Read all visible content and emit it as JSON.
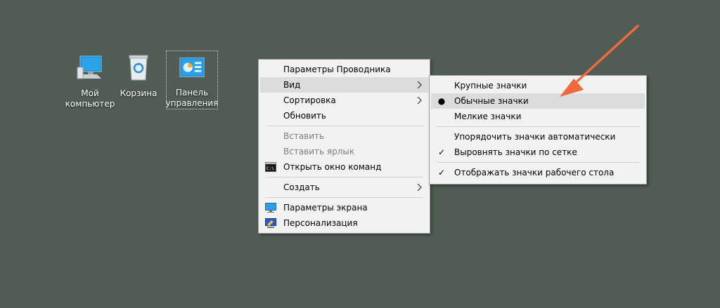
{
  "desktop": {
    "icons": [
      {
        "label": "Мой\nкомпьютер",
        "icon": "computer-icon"
      },
      {
        "label": "Корзина",
        "icon": "recycle-bin-icon"
      },
      {
        "label": "Панель\nуправления",
        "icon": "control-panel-icon"
      }
    ]
  },
  "context_menu": {
    "items": [
      {
        "label": "Параметры Проводника"
      },
      {
        "label": "Вид",
        "submenu": true
      },
      {
        "label": "Сортировка",
        "submenu": true
      },
      {
        "label": "Обновить"
      },
      {
        "label": "Вставить",
        "disabled": true
      },
      {
        "label": "Вставить ярлык",
        "disabled": true
      },
      {
        "label": "Открыть окно команд",
        "icon": "command-prompt-icon"
      },
      {
        "label": "Создать",
        "submenu": true
      },
      {
        "label": "Параметры экрана",
        "icon": "display-settings-icon"
      },
      {
        "label": "Персонализация",
        "icon": "personalization-icon"
      }
    ]
  },
  "view_submenu": {
    "items": [
      {
        "label": "Крупные значки"
      },
      {
        "label": "Обычные значки",
        "mark": "●"
      },
      {
        "label": "Мелкие значки"
      },
      {
        "label": "Упорядочить значки автоматически"
      },
      {
        "label": "Выровнять значки по сетке",
        "mark": "✓"
      },
      {
        "label": "Отображать значки рабочего стола",
        "mark": "✓"
      }
    ]
  },
  "annotation": {
    "color": "#f06a3c",
    "icon": "pointer-arrow-icon"
  }
}
